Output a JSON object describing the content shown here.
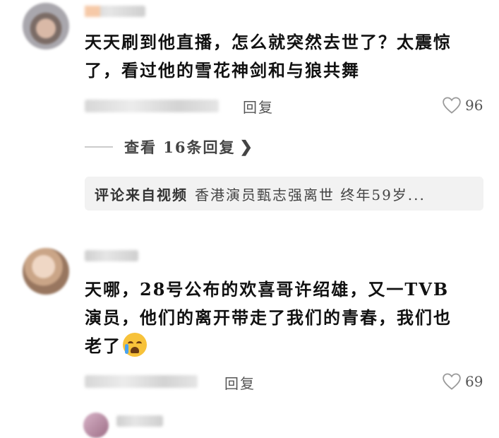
{
  "comments": [
    {
      "text": "天天刷到他直播，怎么就突然去世了？太震惊了，看过他的雪花神剑和与狼共舞",
      "reply_label": "回复",
      "likes": "96",
      "view_replies": "查看 16条回复",
      "source_label": "评论来自视频",
      "source_title": "香港演员甄志强离世 终年59岁..."
    },
    {
      "text": "天哪，28号公布的欢喜哥许绍雄，又一TVB演员，他们的离开带走了我们的青春，我们也老了",
      "reply_label": "回复",
      "likes": "69"
    }
  ],
  "icons": {
    "like": "heart-outline-icon",
    "expand": "chevron-right-icon",
    "emoji": "crying-face-emoji"
  },
  "colors": {
    "text": "#111111",
    "muted": "#555555",
    "source_bg": "#f2f2f2"
  }
}
